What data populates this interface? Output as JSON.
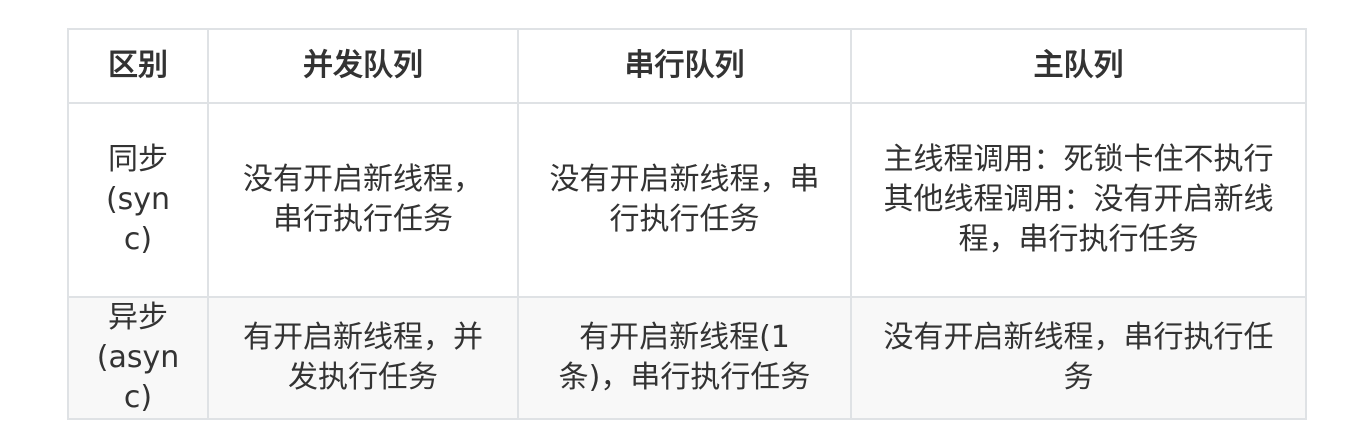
{
  "table": {
    "headers": [
      "区别",
      "并发队列",
      "串行队列",
      "主队列"
    ],
    "rows": [
      {
        "label_line1": "同步",
        "label_line2": "(sync)",
        "concurrent": "没有开启新线程，串行执行任务",
        "serial": "没有开启新线程，串行执行任务",
        "main_line1": "主线程调用：死锁卡住不执行",
        "main_line2": "其他线程调用：没有开启新线程，串行执行任务"
      },
      {
        "label_line1": "异步",
        "label_line2": "(async)",
        "concurrent": "有开启新线程，并发执行任务",
        "serial": "有开启新线程(1条)，串行执行任务",
        "main": "没有开启新线程，串行执行任务"
      }
    ]
  }
}
